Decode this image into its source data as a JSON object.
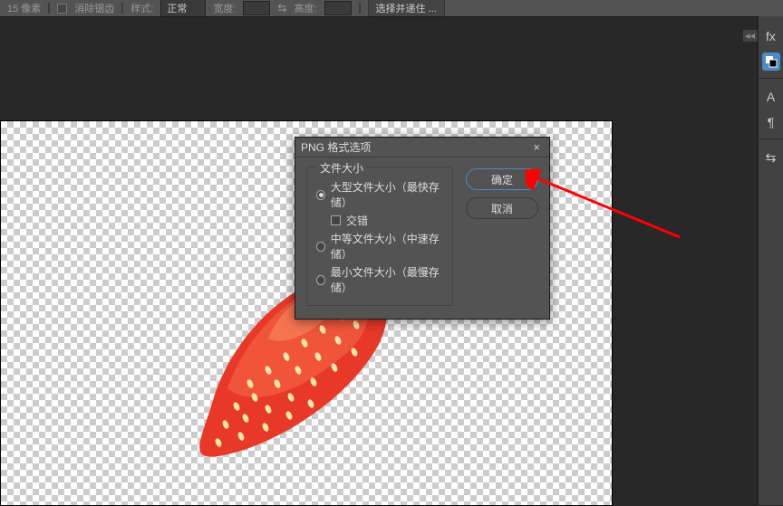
{
  "toolbar": {
    "sampleText": "15 像素",
    "checkbox1Label": "消除锯齿",
    "styleLabel": "样式:",
    "styleValue": "正常",
    "widthLabel": "宽度:",
    "heightLabel": "高度:",
    "selectBtn": "选择并递住 ..."
  },
  "dialog": {
    "title": "PNG 格式选项",
    "fieldsetLegend": "文件大小",
    "opt1": "大型文件大小（最快存储）",
    "opt2Label": "交错",
    "opt3": "中等文件大小（中速存储）",
    "opt4": "最小文件大小（最慢存储）",
    "okBtn": "确定",
    "cancelBtn": "取消"
  },
  "rightPanel": {
    "fx": "fx",
    "a": "A",
    "para": "¶",
    "swap": "⇆"
  }
}
